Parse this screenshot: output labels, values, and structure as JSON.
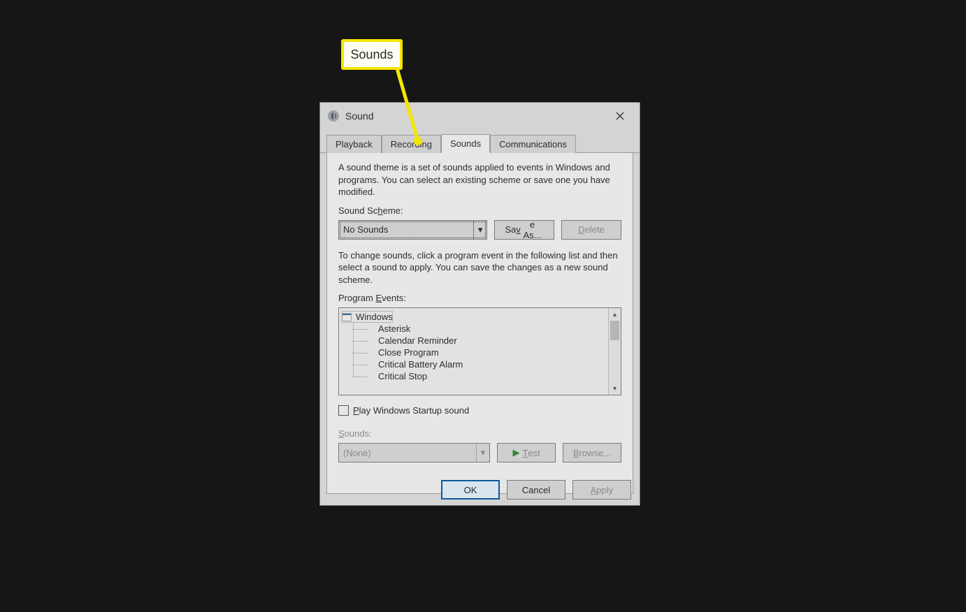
{
  "callout": {
    "label": "Sounds"
  },
  "window": {
    "title": "Sound"
  },
  "tabs": {
    "playback": "Playback",
    "recording": "Recording",
    "sounds": "Sounds",
    "communications": "Communications"
  },
  "text": {
    "theme_desc": "A sound theme is a set of sounds applied to events in Windows and programs.  You can select an existing scheme or save one you have modified.",
    "scheme_label_pre": "Sound Sc",
    "scheme_label_ul": "h",
    "scheme_label_post": "eme:",
    "change_desc": "To change sounds, click a program event in the following list and then select a sound to apply.  You can save the changes as a new sound scheme.",
    "events_label_pre": "Program ",
    "events_label_ul": "E",
    "events_label_post": "vents:",
    "startup_ul": "P",
    "startup_rest": "lay Windows Startup sound",
    "sounds_ul": "S",
    "sounds_rest": "ounds:"
  },
  "scheme": {
    "value": "No Sounds"
  },
  "buttons": {
    "save_as_pre": "Sa",
    "save_as_ul": "v",
    "save_as_post": "e As...",
    "delete_ul": "D",
    "delete_rest": "elete",
    "test_ul": "T",
    "test_rest": "est",
    "browse_ul": "B",
    "browse_rest": "rowse...",
    "ok": "OK",
    "cancel": "Cancel",
    "apply_ul": "A",
    "apply_rest": "pply"
  },
  "events": {
    "root": "Windows",
    "items": [
      "Asterisk",
      "Calendar Reminder",
      "Close Program",
      "Critical Battery Alarm",
      "Critical Stop"
    ]
  },
  "sound_select": {
    "value": "(None)"
  }
}
